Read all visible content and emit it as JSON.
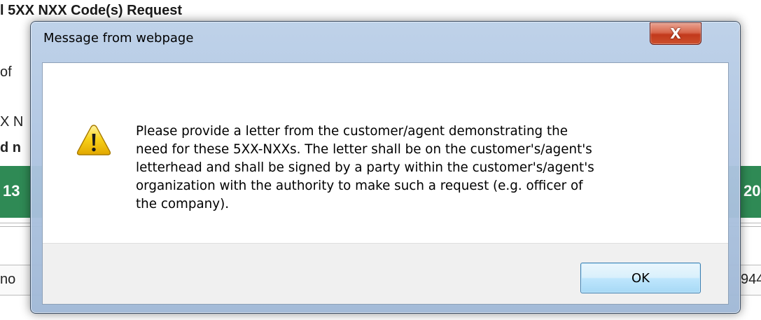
{
  "background": {
    "title_fragment": "l 5XX NXX Code(s) Request",
    "fragments": {
      "line1": "of",
      "line2": "X N",
      "line3": "d n",
      "green_left": "13",
      "green_right": "20",
      "bottom_left": "no",
      "bottom_right": "944"
    },
    "green_band_color": "#2f8a55"
  },
  "dialog": {
    "title": "Message from webpage",
    "close_label": "X",
    "icon": "warning-icon",
    "message": "Please provide a letter from the customer/agent demonstrating the\nneed for these 5XX-NXXs.  The letter shall be on the customer's/agent's\nletterhead and shall be signed by a party within the customer's/agent's\norganization with the authority to make such a request (e.g. officer of\nthe company).",
    "ok_label": "OK",
    "colors": {
      "warning_yellow": "#f5c400",
      "close_red": "#c2391c",
      "ok_border": "#3c7fb1"
    }
  }
}
